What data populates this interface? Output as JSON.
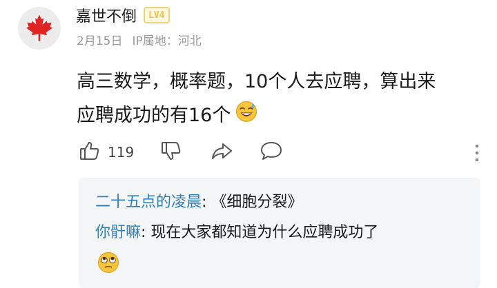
{
  "comment": {
    "username": "嘉世不倒",
    "level": "LV4",
    "date": "2月15日",
    "ip_label": "IP属地：河北",
    "content_line1": "高三数学，概率题，10个人去应聘，算出来",
    "content_line2": "应聘成功的有16个",
    "likes": "119",
    "emoji_icon": "laughing-with-sweat-emoji"
  },
  "replies": [
    {
      "name": "二十五点的凌晨",
      "separator": ": ",
      "text": "《细胞分裂》"
    },
    {
      "name": "你骬嘛",
      "separator": ": ",
      "text": "现在大家都知道为什么应聘成功了",
      "emoji_icon": "rolling-eyes-emoji"
    }
  ],
  "colors": {
    "reply_name": "#2e7fb8",
    "meta_text": "#9a9a9a",
    "reply_bg": "#f4f5f7",
    "maple": "#e02323",
    "level_badge": "#f0c24a"
  }
}
